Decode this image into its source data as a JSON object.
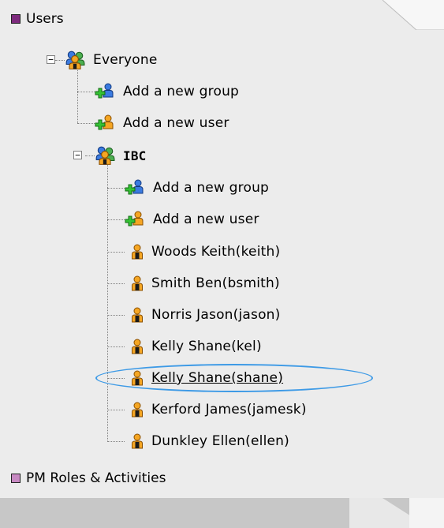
{
  "sections": {
    "users": {
      "label": "Users",
      "color": "#7e2b7e"
    },
    "pm_roles": {
      "label": "PM Roles & Activities",
      "color": "#c789c2"
    }
  },
  "tree": {
    "everyone": {
      "label": "Everyone",
      "expander": "−",
      "add_group": "Add a new group",
      "add_user": "Add a new user"
    },
    "ibc": {
      "label": "IBC",
      "expander": "−",
      "add_group": "Add a new group",
      "add_user": "Add a new user",
      "users": [
        {
          "label": "Woods Keith(keith)"
        },
        {
          "label": "Smith Ben(bsmith)"
        },
        {
          "label": "Norris Jason(jason)"
        },
        {
          "label": "Kelly Shane(kel)"
        },
        {
          "label": "Kelly Shane(shane)",
          "selected": true
        },
        {
          "label": "Kerford James(jamesk)"
        },
        {
          "label": "Dunkley Ellen(ellen)"
        }
      ]
    }
  },
  "icons": {
    "group": "group-icon",
    "add_group": "add-group-icon",
    "add_user": "add-user-icon",
    "user": "user-icon"
  },
  "colors": {
    "highlight": "#3d9ae6",
    "user_orange": "#f0a020",
    "group_blue": "#2b6fd6",
    "add_green": "#2eb82e"
  }
}
